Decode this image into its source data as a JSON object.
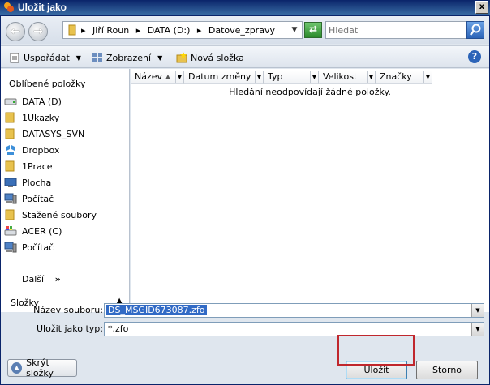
{
  "window": {
    "title": "Uložit jako",
    "close_glyph": "x"
  },
  "nav": {
    "back_glyph": "←",
    "forward_glyph": "→",
    "breadcrumbs": [
      "▸",
      "Jiří Roun",
      "▸",
      "DATA (D:)",
      "▸",
      "Datove_zpravy"
    ],
    "address_dropdown_glyph": "▼",
    "refresh_glyph": "⇄",
    "search_placeholder": "Hledat"
  },
  "toolbar": {
    "organize_label": "Uspořádat",
    "views_label": "Zobrazení",
    "new_folder_label": "Nová složka",
    "arrow_glyph": "▼",
    "help_glyph": "?"
  },
  "navpane": {
    "header": "Oblíbené položky",
    "items": [
      {
        "label": "DATA (D)",
        "icon": "drive-icon"
      },
      {
        "label": "1Ukazky",
        "icon": "folder-icon"
      },
      {
        "label": "DATASYS_SVN",
        "icon": "folder-icon"
      },
      {
        "label": "Dropbox",
        "icon": "dropbox-icon"
      },
      {
        "label": "1Prace",
        "icon": "folder-icon"
      },
      {
        "label": "Plocha",
        "icon": "desktop-icon"
      },
      {
        "label": "Počítač",
        "icon": "computer-icon"
      },
      {
        "label": "Stažené soubory",
        "icon": "folder-icon"
      },
      {
        "label": "ACER (C)",
        "icon": "windows-drive-icon"
      },
      {
        "label": "Počítač",
        "icon": "computer-icon"
      }
    ],
    "more_label": "Další",
    "more_glyph": "»",
    "folders_label": "Složky",
    "collapse_glyph": "▲"
  },
  "filelist": {
    "columns": [
      "Název",
      "Datum změny",
      "Typ",
      "Velikost",
      "Značky"
    ],
    "sort_glyph": "▲",
    "column_dropdown_glyph": "▼",
    "empty_message": "Hledání neodpovídají žádné položky."
  },
  "form": {
    "filename_label": "Název souboru:",
    "filename_value": "DS_MSGID673087.zfo",
    "filetype_label": "Uložit jako typ:",
    "filetype_value": "*.zfo",
    "dropdown_glyph": "▼"
  },
  "footer": {
    "hide_folders_label": "Skrýt složky",
    "hide_glyph": "▲",
    "save_label": "Uložit",
    "cancel_label": "Storno"
  },
  "colors": {
    "highlight": "#c0272d",
    "titlebar": "#0a246a",
    "selection": "#316ac5"
  }
}
